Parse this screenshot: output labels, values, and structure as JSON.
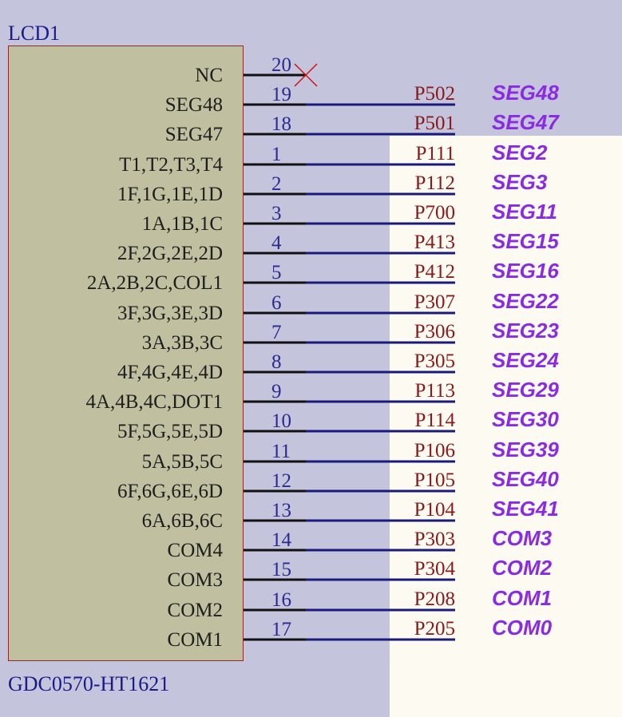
{
  "component": {
    "ref": "LCD1",
    "value": "GDC0570-HT1621"
  },
  "pins": [
    {
      "name": "NC",
      "number": "20",
      "net": "",
      "label": "",
      "no_connect": true
    },
    {
      "name": "SEG48",
      "number": "19",
      "net": "P502",
      "label": "SEG48"
    },
    {
      "name": "SEG47",
      "number": "18",
      "net": "P501",
      "label": "SEG47"
    },
    {
      "name": "T1,T2,T3,T4",
      "number": "1",
      "net": "P111",
      "label": "SEG2"
    },
    {
      "name": "1F,1G,1E,1D",
      "number": "2",
      "net": "P112",
      "label": "SEG3"
    },
    {
      "name": "1A,1B,1C",
      "number": "3",
      "net": "P700",
      "label": "SEG11"
    },
    {
      "name": "2F,2G,2E,2D",
      "number": "4",
      "net": "P413",
      "label": "SEG15"
    },
    {
      "name": "2A,2B,2C,COL1",
      "number": "5",
      "net": "P412",
      "label": "SEG16"
    },
    {
      "name": "3F,3G,3E,3D",
      "number": "6",
      "net": "P307",
      "label": "SEG22"
    },
    {
      "name": "3A,3B,3C",
      "number": "7",
      "net": "P306",
      "label": "SEG23"
    },
    {
      "name": "4F,4G,4E,4D",
      "number": "8",
      "net": "P305",
      "label": "SEG24"
    },
    {
      "name": "4A,4B,4C,DOT1",
      "number": "9",
      "net": "P113",
      "label": "SEG29"
    },
    {
      "name": "5F,5G,5E,5D",
      "number": "10",
      "net": "P114",
      "label": "SEG30"
    },
    {
      "name": "5A,5B,5C",
      "number": "11",
      "net": "P106",
      "label": "SEG39"
    },
    {
      "name": "6F,6G,6E,6D",
      "number": "12",
      "net": "P105",
      "label": "SEG40"
    },
    {
      "name": "6A,6B,6C",
      "number": "13",
      "net": "P104",
      "label": "SEG41"
    },
    {
      "name": "COM4",
      "number": "14",
      "net": "P303",
      "label": "COM3"
    },
    {
      "name": "COM3",
      "number": "15",
      "net": "P304",
      "label": "COM2"
    },
    {
      "name": "COM2",
      "number": "16",
      "net": "P208",
      "label": "COM1"
    },
    {
      "name": "COM1",
      "number": "17",
      "net": "P205",
      "label": "COM0"
    }
  ],
  "colors": {
    "background": "#c4c4dc",
    "background_light": "#fdfaf2",
    "component_fill": "#c0c0a0",
    "pin_line": "#111111",
    "wire": "#1a1a7a",
    "net_text": "#8a1a1a",
    "seg_text": "#8a2be2",
    "no_connect": "#d01010"
  }
}
